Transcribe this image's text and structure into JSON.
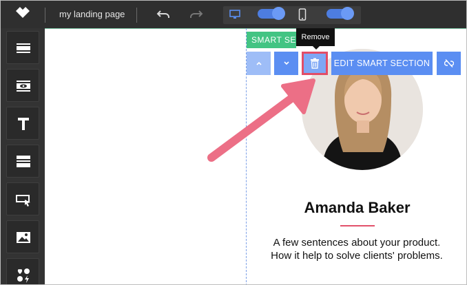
{
  "app": {
    "title": "my landing page"
  },
  "topbar": {
    "icons": [
      "logo-icon",
      "undo-icon",
      "redo-icon",
      "desktop-icon",
      "mobile-icon"
    ],
    "desktop_toggle_on": true,
    "mobile_toggle_on": true
  },
  "sidebar": {
    "tools": [
      "section-tool-icon",
      "hidden-section-tool-icon",
      "text-tool-icon",
      "rows-tool-icon",
      "button-tool-icon",
      "image-tool-icon",
      "widgets-tool-icon"
    ]
  },
  "section": {
    "label": "SMART SECTION",
    "tooltip": "Remove",
    "toolbar": {
      "edit_label": "EDIT SMART SECTION"
    }
  },
  "content": {
    "name": "Amanda Baker",
    "description": "A few sentences about your product. How it help to solve clients' problems."
  },
  "colors": {
    "topbar": "#2f2f2f",
    "sidebar": "#333333",
    "accent_blue": "#5b8ef2",
    "smart_label_green": "#43c483",
    "highlight_red": "#e24d67",
    "arrow_pink": "#ec6f86"
  }
}
